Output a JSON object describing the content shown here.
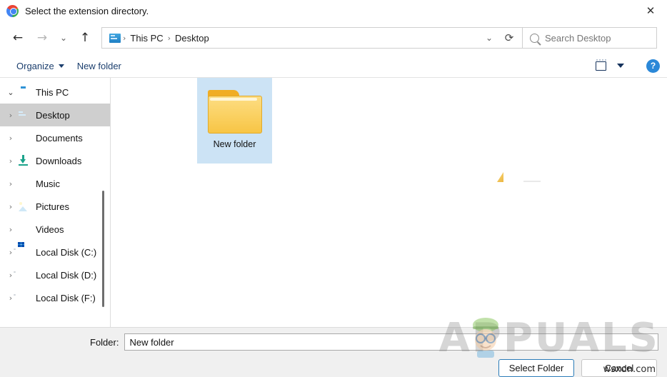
{
  "window": {
    "title": "Select the extension directory.",
    "app_icon": "chrome-icon",
    "close_label": "✕"
  },
  "nav": {
    "back": "←",
    "forward": "→",
    "recent": "⌄",
    "up": "↑",
    "dropdown": "⌄",
    "refresh": "⟳",
    "breadcrumbs": [
      "This PC",
      "Desktop"
    ],
    "separator": "›"
  },
  "search": {
    "placeholder": "Search Desktop",
    "icon": "search-icon"
  },
  "toolbar": {
    "organize_label": "Organize",
    "new_folder_label": "New folder",
    "view_icon": "view-mode-icon",
    "help_label": "?"
  },
  "sidebar": {
    "items": [
      {
        "label": "This PC",
        "icon": "computer-icon",
        "level": 0,
        "chevron": "⌄",
        "expanded": true,
        "selected": false
      },
      {
        "label": "Desktop",
        "icon": "desktop-icon",
        "level": 1,
        "chevron": "›",
        "expanded": false,
        "selected": true
      },
      {
        "label": "Documents",
        "icon": "documents-icon",
        "level": 1,
        "chevron": "›",
        "expanded": false,
        "selected": false
      },
      {
        "label": "Downloads",
        "icon": "downloads-icon",
        "level": 1,
        "chevron": "›",
        "expanded": false,
        "selected": false
      },
      {
        "label": "Music",
        "icon": "music-icon",
        "level": 1,
        "chevron": "›",
        "expanded": false,
        "selected": false
      },
      {
        "label": "Pictures",
        "icon": "pictures-icon",
        "level": 1,
        "chevron": "›",
        "expanded": false,
        "selected": false
      },
      {
        "label": "Videos",
        "icon": "videos-icon",
        "level": 1,
        "chevron": "›",
        "expanded": false,
        "selected": false
      },
      {
        "label": "Local Disk (C:)",
        "icon": "windows-disk-icon",
        "level": 1,
        "chevron": "›",
        "expanded": false,
        "selected": false
      },
      {
        "label": "Local Disk (D:)",
        "icon": "disk-icon",
        "level": 1,
        "chevron": "›",
        "expanded": false,
        "selected": false
      },
      {
        "label": "Local Disk (F:)",
        "icon": "disk-icon",
        "level": 1,
        "chevron": "›",
        "expanded": false,
        "selected": false
      }
    ]
  },
  "files": [
    {
      "name": "New folder",
      "icon": "folder-icon",
      "selected": true
    }
  ],
  "footer": {
    "folder_label": "Folder:",
    "folder_value": "New folder",
    "select_button": "Select Folder",
    "cancel_button": "Cancel"
  },
  "watermark": {
    "brand": "APPUALS",
    "site": "wsxdn.com"
  },
  "colors": {
    "selection_blue": "#cce3f5",
    "sidebar_selection": "#cfcfcf",
    "accent_button_border": "#2b7cb8",
    "help_blue": "#2b88d8",
    "folder_yellow": "#fbd265",
    "toolbar_text": "#1c3f6e"
  }
}
